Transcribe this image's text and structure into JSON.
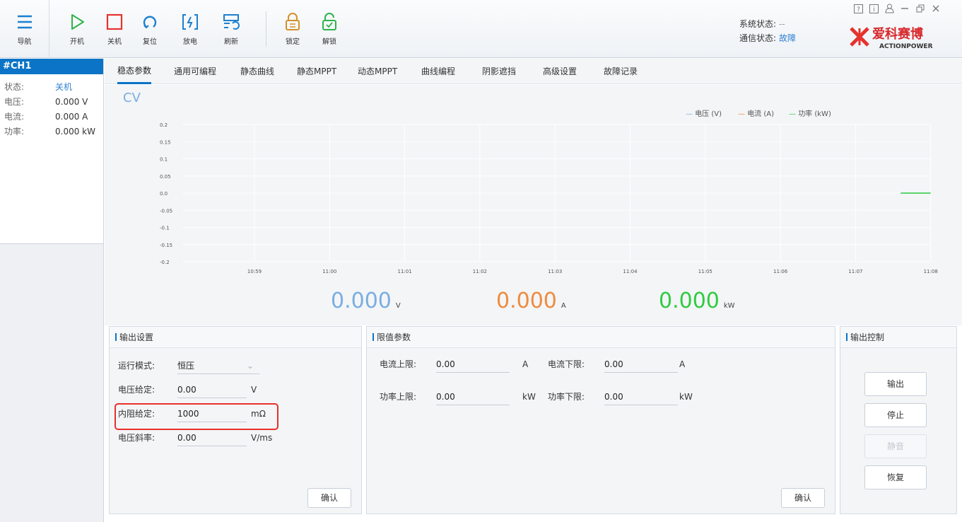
{
  "toolbar": {
    "nav": "导航",
    "start": "开机",
    "shutdown": "关机",
    "reset": "复位",
    "discharge": "放电",
    "refresh": "刷新",
    "lock": "锁定",
    "unlock": "解锁"
  },
  "status": {
    "system_label": "系统状态:",
    "system_value": "--",
    "comm_label": "通信状态:",
    "comm_value": "故障"
  },
  "window_controls": [
    "?",
    "i",
    "user",
    "–",
    "restore",
    "×"
  ],
  "brand": {
    "name": "爱科赛博",
    "sub": "ACTIONPOWER"
  },
  "channel": {
    "name": "#CH1",
    "rows": [
      {
        "label": "状态:",
        "value": "关机"
      },
      {
        "label": "电压:",
        "value": "0.000 V"
      },
      {
        "label": "电流:",
        "value": "0.000 A"
      },
      {
        "label": "功率:",
        "value": "0.000 kW"
      }
    ]
  },
  "tabs": [
    "稳态参数",
    "通用可编程",
    "静态曲线",
    "静态MPPT",
    "动态MPPT",
    "曲线编程",
    "阴影遮挡",
    "高级设置",
    "故障记录"
  ],
  "active_tab": 0,
  "mode": "CV",
  "chart_data": {
    "type": "line",
    "x": [
      "10:59",
      "11:00",
      "11:01",
      "11:02",
      "11:03",
      "11:04",
      "11:05",
      "11:06",
      "11:07",
      "11:08"
    ],
    "yticks": [
      "0.2",
      "0.15",
      "0.1",
      "0.05",
      "0.0",
      "-0.05",
      "-0.1",
      "-0.15",
      "-0.2"
    ],
    "ylim": [
      -0.2,
      0.2
    ],
    "series": [
      {
        "name": "电压 (V)",
        "color": "#7aaee0",
        "points": []
      },
      {
        "name": "电流 (A)",
        "color": "#f08a3c",
        "points": []
      },
      {
        "name": "功率 (kW)",
        "color": "#2ecc40",
        "points": [
          [
            "11:07.6",
            0.0
          ],
          [
            "11:08",
            0.0
          ]
        ]
      }
    ],
    "legend": "top-right",
    "grid": true
  },
  "readouts": {
    "voltage": {
      "value": "0.000",
      "unit": "V",
      "color": "#7aaee0"
    },
    "current": {
      "value": "0.000",
      "unit": "A",
      "color": "#f08a3c"
    },
    "power": {
      "value": "0.000",
      "unit": "kW",
      "color": "#2ecc40"
    }
  },
  "output_settings": {
    "title": "输出设置",
    "mode_label": "运行模式:",
    "mode_value": "恒压",
    "voltage_label": "电压给定:",
    "voltage_value": "0.00",
    "voltage_unit": "V",
    "resistance_label": "内阻给定:",
    "resistance_value": "1000",
    "resistance_unit": "mΩ",
    "slope_label": "电压斜率:",
    "slope_value": "0.00",
    "slope_unit": "V/ms",
    "confirm": "确认"
  },
  "limits": {
    "title": "限值参数",
    "current_upper_label": "电流上限:",
    "current_upper_value": "0.00",
    "current_upper_unit": "A",
    "current_lower_label": "电流下限:",
    "current_lower_value": "0.00",
    "current_lower_unit": "A",
    "power_upper_label": "功率上限:",
    "power_upper_value": "0.00",
    "power_upper_unit": "kW",
    "power_lower_label": "功率下限:",
    "power_lower_value": "0.00",
    "power_lower_unit": "kW",
    "confirm": "确认"
  },
  "output_control": {
    "title": "输出控制",
    "output": "输出",
    "stop": "停止",
    "mute": "静音",
    "restore": "恢复"
  }
}
